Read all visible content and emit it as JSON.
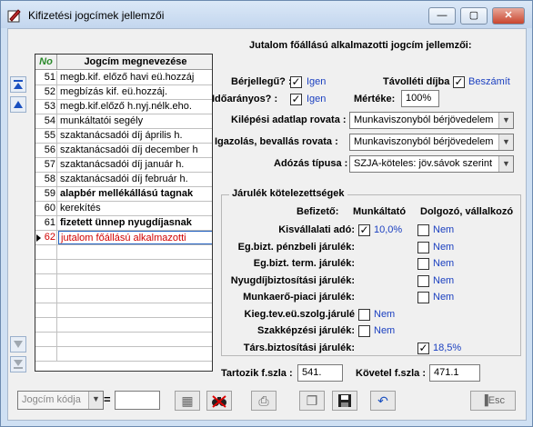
{
  "window": {
    "title": "Kifizetési jogcímek jellemzői",
    "controls": [
      "—",
      "▢",
      "✕"
    ]
  },
  "grid": {
    "col_no": "No",
    "col_name": "Jogcím megnevezése",
    "rows": [
      {
        "no": "51",
        "name": "megb.kif. előző havi eü.hozzáj",
        "bold": false
      },
      {
        "no": "52",
        "name": "megbízás kif. eü.hozzáj.",
        "bold": false
      },
      {
        "no": "53",
        "name": "megb.kif.előző h.nyj.nélk.eho.",
        "bold": false
      },
      {
        "no": "54",
        "name": "munkáltatói segély",
        "bold": false
      },
      {
        "no": "55",
        "name": "szaktanácsadói díj április h.",
        "bold": false
      },
      {
        "no": "56",
        "name": "szaktanácsadói díj december h",
        "bold": false
      },
      {
        "no": "57",
        "name": "szaktanácsadói díj január h.",
        "bold": false
      },
      {
        "no": "58",
        "name": "szaktanácsadói díj február h.",
        "bold": false
      },
      {
        "no": "59",
        "name": "alapbér mellékállású tagnak",
        "bold": true
      },
      {
        "no": "60",
        "name": "kerekítés",
        "bold": false
      },
      {
        "no": "61",
        "name": "fizetett ünnep nyugdíjasnak",
        "bold": true
      },
      {
        "no": "62",
        "name": "jutalom főállású alkalmazotti",
        "bold": false,
        "selected": true
      }
    ],
    "empty_rows": 8
  },
  "form": {
    "heading": "Jutalom főállású alkalmazotti jogcím jellemzői:",
    "berjellegu_label": "Bérjellegű? :",
    "berjellegu_value": "Igen",
    "tavolleti_label": "Távolléti díjba",
    "tavolleti_value": "Beszámít",
    "idoaranyos_label": "Időarányos? :",
    "idoaranyos_value": "Igen",
    "mertek_label": "Mértéke:",
    "mertek_value": "100%",
    "kilepesi_label": "Kilépési adatlap rovata :",
    "kilepesi_value": "Munkaviszonyból bérjövedelem",
    "igazolas_label": "Igazolás, bevallás rovata :",
    "igazolas_value": "Munkaviszonyból bérjövedelem",
    "adozas_label": "Adózás típusa :",
    "adozas_value": "SZJA-köteles: jöv.sávok szerint"
  },
  "contributions": {
    "title": "Járulék kötelezettségek",
    "col_befizeto": "Befizető:",
    "col_munkaltato": "Munkáltató",
    "col_dolgozo": "Dolgozó, vállalkozó",
    "rows": [
      {
        "label": "Kisvállalati adó:",
        "employer_checked": true,
        "employer_text": "10,0%",
        "employee_checked": false,
        "employee_text": "Nem"
      },
      {
        "label": "Eg.bizt. pénzbeli járulék:",
        "employee_checked": false,
        "employee_text": "Nem"
      },
      {
        "label": "Eg.bizt. term. járulék:",
        "employee_checked": false,
        "employee_text": "Nem"
      },
      {
        "label": "Nyugdíjbiztosítási járulék:",
        "employee_checked": false,
        "employee_text": "Nem"
      },
      {
        "label": "Munkaerő-piaci járulék:",
        "employee_checked": false,
        "employee_text": "Nem"
      },
      {
        "label": "Kieg.tev.eü.szolg.járulé",
        "employer_checked": false,
        "employer_text": "Nem"
      },
      {
        "label": "Szakképzési járulék:",
        "employer_checked": false,
        "employer_text": "Nem"
      },
      {
        "label": "Társ.biztosítási járulék:",
        "employee_checked": true,
        "employee_text": "18,5%"
      }
    ]
  },
  "accounts": {
    "tartozik_label": "Tartozik f.szla :",
    "tartozik_value": "541.",
    "kovetel_label": "Követel f.szla :",
    "kovetel_value": "471.1"
  },
  "toolbar": {
    "search_combo": "Jogcím kódja",
    "equals": "=",
    "search_value": "",
    "esc_label": "Esc"
  }
}
